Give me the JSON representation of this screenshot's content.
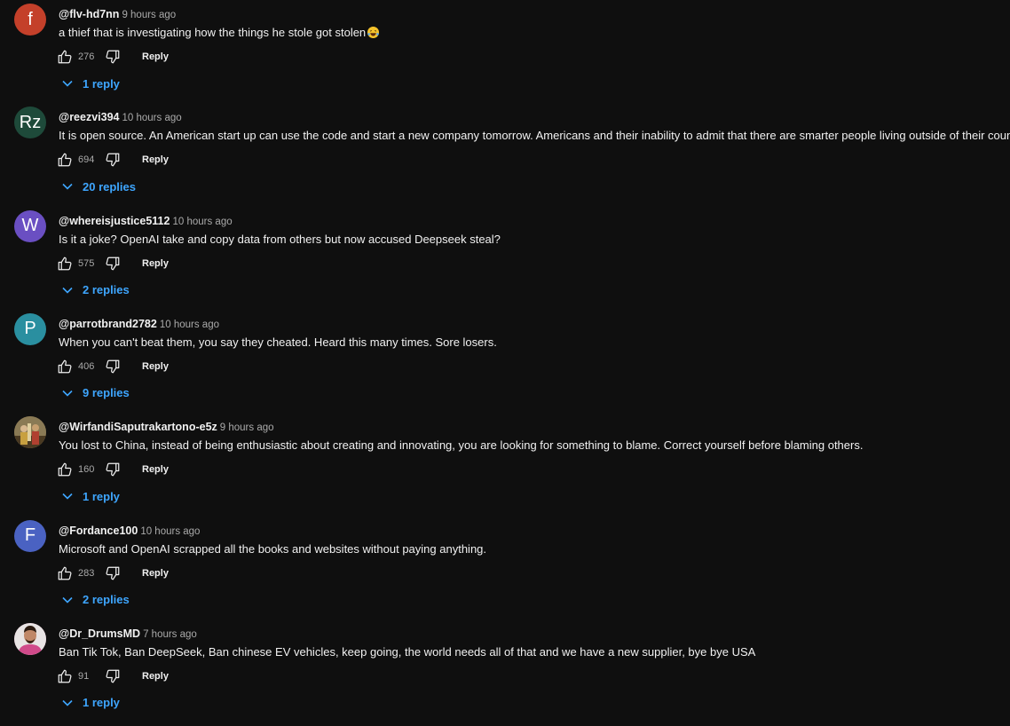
{
  "comments": [
    {
      "avatar_letter": "f",
      "avatar_color": "#c4402a",
      "handle": "@flv-hd7nn",
      "time": "9 hours ago",
      "text": "a thief that is investigating how the things he stole got stolen",
      "emoji": "rolling-on-floor-laughing-emoji",
      "likes": "276",
      "reply_label": "Reply",
      "replies_label": "1 reply"
    },
    {
      "avatar_letter": "Rz",
      "avatar_color": "#1e4a3a",
      "handle": "@reezvi394",
      "time": "10 hours ago",
      "text": "It is open source. An American start up can use the code and start a new company tomorrow. Americans and their inability to admit that there are smarter people living outside of their country.",
      "likes": "694",
      "reply_label": "Reply",
      "replies_label": "20 replies"
    },
    {
      "avatar_letter": "W",
      "avatar_color": "#6a4fc2",
      "handle": "@whereisjustice5112",
      "time": "10 hours ago",
      "text": "Is it a joke? OpenAI take and copy data from others but now accused Deepseek steal?",
      "likes": "575",
      "reply_label": "Reply",
      "replies_label": "2 replies"
    },
    {
      "avatar_letter": "P",
      "avatar_color": "#2a8fa0",
      "handle": "@parrotbrand2782",
      "time": "10 hours ago",
      "text": "When you can't beat them, you say they cheated. Heard this many times. Sore losers.",
      "likes": "406",
      "reply_label": "Reply",
      "replies_label": "9 replies"
    },
    {
      "avatar_letter": "",
      "avatar_color": "#6b5a3a",
      "avatar_kind": "photo-group",
      "handle": "@WirfandiSaputrakartono-e5z",
      "time": "9 hours ago",
      "text": "You lost to China, instead of being enthusiastic about creating and innovating, you are looking for something to blame. Correct yourself before blaming others.",
      "likes": "160",
      "reply_label": "Reply",
      "replies_label": "1 reply"
    },
    {
      "avatar_letter": "F",
      "avatar_color": "#4a62c2",
      "handle": "@Fordance100",
      "time": "10 hours ago",
      "text": "Microsoft and OpenAI scrapped all the books and websites without paying anything.",
      "likes": "283",
      "reply_label": "Reply",
      "replies_label": "2 replies"
    },
    {
      "avatar_letter": "",
      "avatar_color": "#c05a8a",
      "avatar_kind": "photo-person",
      "handle": "@Dr_DrumsMD",
      "time": "7 hours ago",
      "text": "Ban Tik Tok, Ban DeepSeek, Ban chinese EV vehicles, keep going, the world needs all of that and we have a new supplier, bye bye USA",
      "likes": "91",
      "reply_label": "Reply",
      "replies_label": "1 reply"
    }
  ],
  "icons": {
    "like": "thumb-up-icon",
    "dislike": "thumb-down-icon",
    "expand": "chevron-down-icon"
  },
  "colors": {
    "background": "#0f0f0f",
    "text": "#f1f1f1",
    "secondary_text": "#aaaaaa",
    "link": "#3ea6ff"
  }
}
